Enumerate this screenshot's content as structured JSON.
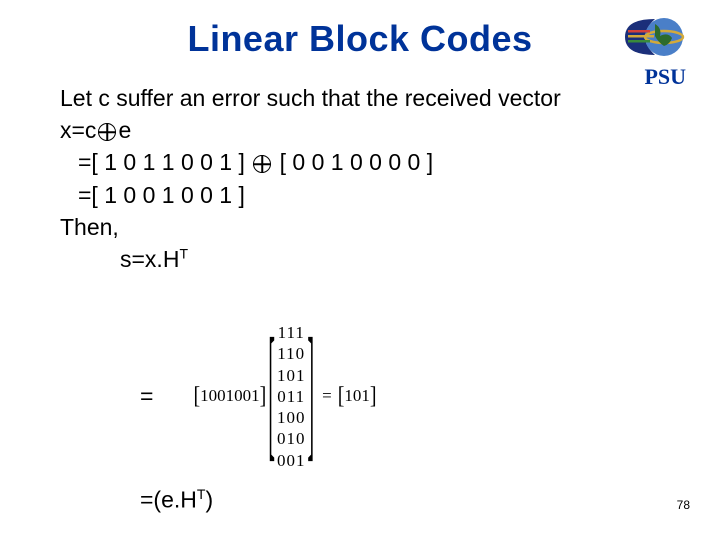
{
  "title": "Linear Block Codes",
  "institution": "PSU",
  "content": {
    "line1": "Let c suffer an error such that the received vector",
    "x_lhs": "x=c",
    "x_rhs": "e",
    "step1_a": "=[ 1 0 1 1 0 0 1 ]",
    "step1_b": "[ 0 0 1 0 0 0 0 ]",
    "step2": "=[ 1 0 0 1 0 0 1 ]",
    "then": "Then,",
    "s_expr_pre": "s=x.H",
    "s_expr_sup": "T",
    "eq_sign": "=",
    "row_vec": "1001001",
    "matrix": [
      "111",
      "110",
      "101",
      "011",
      "100",
      "010",
      "001"
    ],
    "mid_eq": "=",
    "result": "101",
    "eht_pre": "=(e.H",
    "eht_sup": "T",
    "eht_post": ")"
  },
  "page_number": "78"
}
